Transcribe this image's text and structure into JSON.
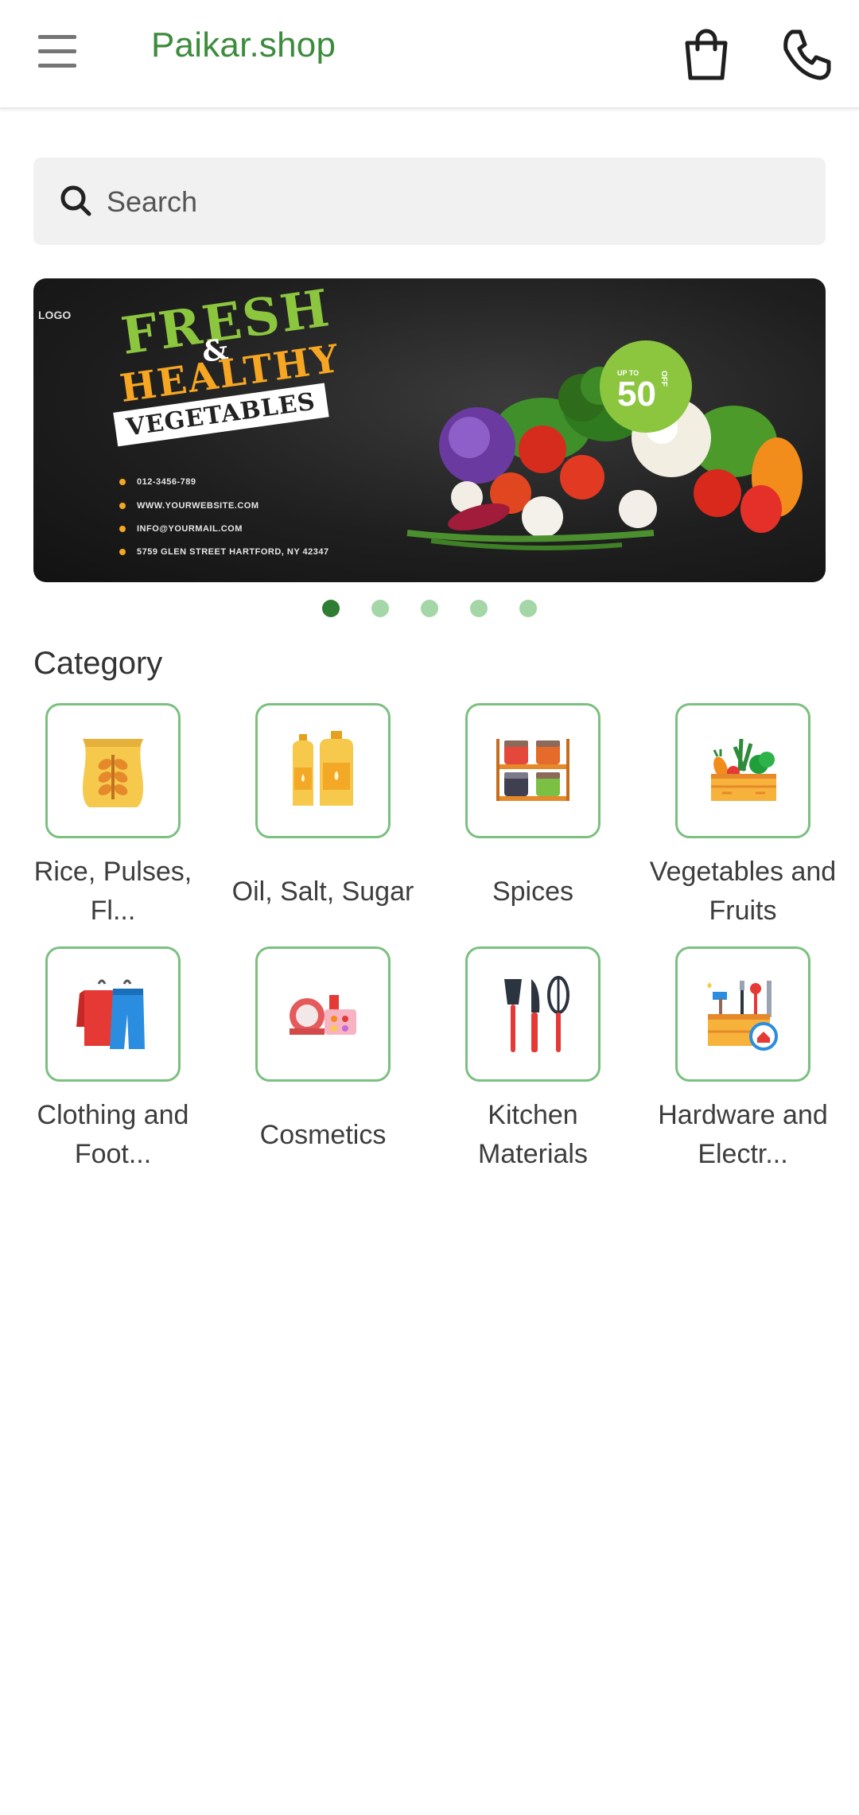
{
  "header": {
    "brand": "Paikar.shop",
    "menu_icon": "hamburger-menu-icon",
    "cart_icon": "shopping-bag-icon",
    "phone_icon": "phone-icon",
    "brand_color": "#3d8b3d"
  },
  "search": {
    "placeholder": "Search",
    "icon": "search-icon"
  },
  "banner": {
    "logo": "LOGO",
    "line1": "FRESH",
    "amp": "&",
    "line2": "HEALTHY",
    "line3": "VEGETABLES",
    "badge_upto": "UP TO",
    "badge_value": "50",
    "badge_pct": "%",
    "badge_off": "OFF",
    "contacts": [
      "012-3456-789",
      "WWW.YOURWEBSITE.COM",
      "INFO@YOURMAIL.COM",
      "5759 GLEN STREET HARTFORD, NY 42347"
    ],
    "carousel_count": 5,
    "carousel_active": 1,
    "accent_green": "#8cc63f",
    "accent_orange": "#f6a623"
  },
  "category": {
    "title": "Category",
    "items": [
      {
        "label": "Rice, Pulses, Fl...",
        "icon": "rice-sack-icon"
      },
      {
        "label": "Oil, Salt, Sugar",
        "icon": "oil-bottles-icon"
      },
      {
        "label": "Spices",
        "icon": "spice-jars-icon"
      },
      {
        "label": "Vegetables and Fruits",
        "icon": "vegetable-crate-icon"
      },
      {
        "label": "Clothing and Foot...",
        "icon": "clothing-icon"
      },
      {
        "label": "Cosmetics",
        "icon": "cosmetics-icon"
      },
      {
        "label": "Kitchen Materials",
        "icon": "kitchen-utensils-icon"
      },
      {
        "label": "Hardware and Electr...",
        "icon": "toolbox-icon"
      }
    ],
    "border_color": "#7cc07f"
  }
}
